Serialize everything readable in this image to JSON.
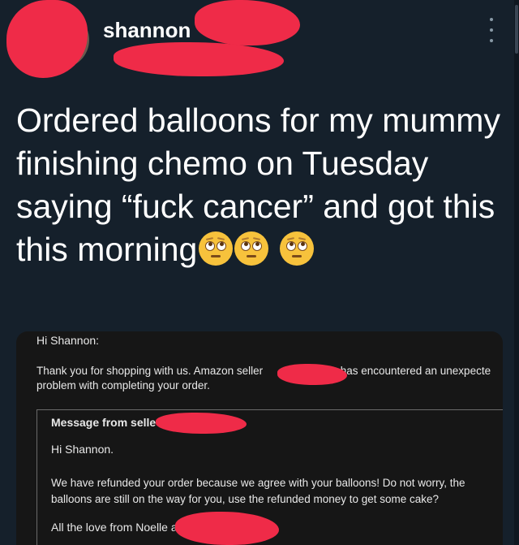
{
  "tweet": {
    "author_name": "shannon",
    "text": "Ordered balloons for my mummy finishing chemo on Tuesday saying “fuck cancer” and got this this morning",
    "emoji_icons": [
      "face-with-rolling-eyes-icon",
      "face-with-rolling-eyes-icon",
      "face-with-rolling-eyes-icon"
    ]
  },
  "email": {
    "greeting": "Hi Shannon:",
    "body_line1_part1": "Thank you for shopping with us. Amazon seller",
    "body_line1_part2": "has encountered an unexpecte",
    "body_line2": "problem with completing your order.",
    "message_title": "Message from selle",
    "message_greeting": "Hi Shannon.",
    "message_body": "We have refunded your order because we agree with your balloons! Do not worry, the balloons are still on the way for you, use the refunded money to get some cake?",
    "message_signoff": "All the love from Noelle a"
  },
  "colors": {
    "background": "#15202b",
    "redaction": "#ef2b48",
    "muted_text": "#8899a6"
  }
}
